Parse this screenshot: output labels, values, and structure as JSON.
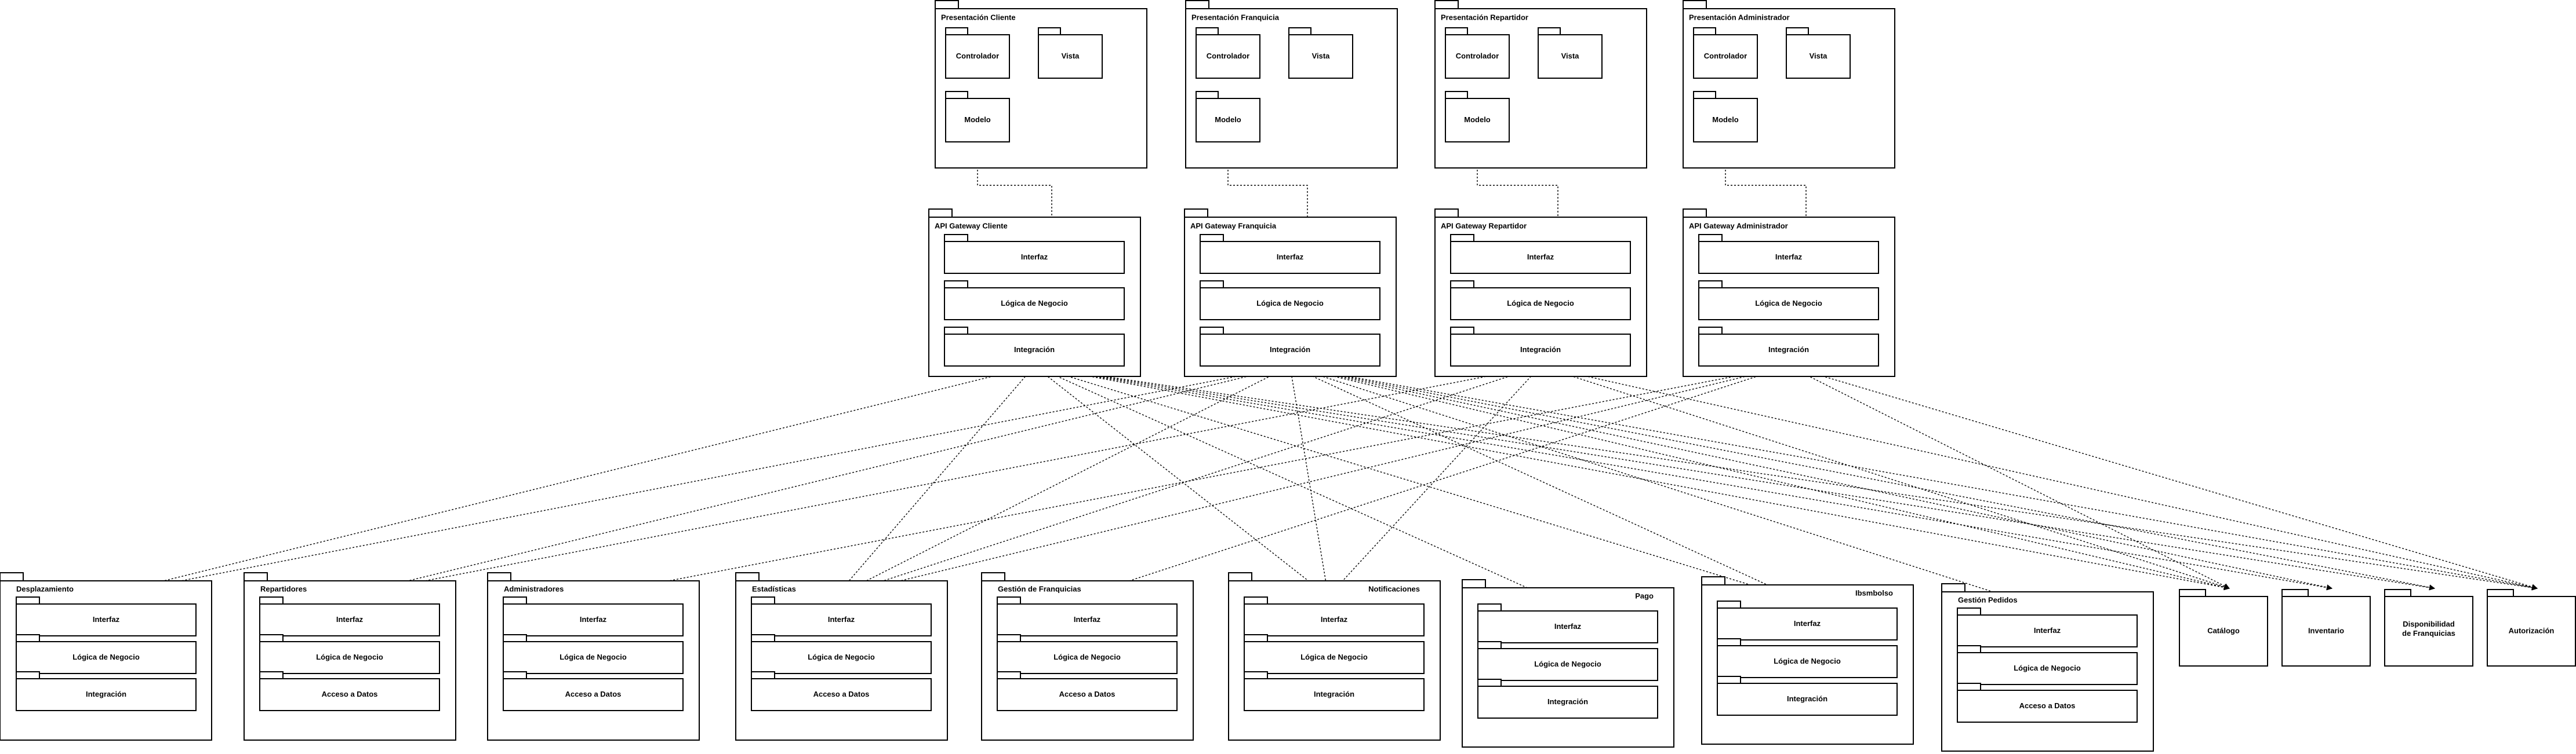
{
  "presentation": [
    {
      "title": "Presentación Cliente",
      "controlador": "Controlador",
      "vista": "Vista",
      "modelo": "Modelo"
    },
    {
      "title": "Presentación Franquicia",
      "controlador": "Controlador",
      "vista": "Vista",
      "modelo": "Modelo"
    },
    {
      "title": "Presentación Repartidor",
      "controlador": "Controlador",
      "vista": "Vista",
      "modelo": "Modelo"
    },
    {
      "title": "Presentación Administrador",
      "controlador": "Controlador",
      "vista": "Vista",
      "modelo": "Modelo"
    }
  ],
  "gateways": [
    {
      "title": "API Gateway Cliente",
      "layers": [
        "Interfaz",
        "Lógica de Negocio",
        "Integración"
      ]
    },
    {
      "title": "API Gateway Franquicia",
      "layers": [
        "Interfaz",
        "Lógica de Negocio",
        "Integración"
      ]
    },
    {
      "title": "API Gateway Repartidor",
      "layers": [
        "Interfaz",
        "Lógica de Negocio",
        "Integración"
      ]
    },
    {
      "title": "API Gateway Administrador",
      "layers": [
        "Interfaz",
        "Lógica de Negocio",
        "Integración"
      ]
    }
  ],
  "services": [
    {
      "title": "Desplazamiento",
      "layers": [
        "Interfaz",
        "Lógica de Negocio",
        "Integración"
      ]
    },
    {
      "title": "Repartidores",
      "layers": [
        "Interfaz",
        "Lógica de Negocio",
        "Acceso a Datos"
      ]
    },
    {
      "title": "Administradores",
      "layers": [
        "Interfaz",
        "Lógica de Negocio",
        "Acceso a Datos"
      ]
    },
    {
      "title": "Estadísticas",
      "layers": [
        "Interfaz",
        "Lógica de Negocio",
        "Acceso a Datos"
      ]
    },
    {
      "title": "Gestión de Franquicias",
      "layers": [
        "Interfaz",
        "Lógica de Negocio",
        "Acceso a Datos"
      ]
    },
    {
      "title": "Notificaciones",
      "layers": [
        "Interfaz",
        "Lógica de Negocio",
        "Integración"
      ]
    },
    {
      "title": "Pago",
      "layers": [
        "Interfaz",
        "Lógica de Negocio",
        "Integración"
      ]
    },
    {
      "title": "Ibsmbolso",
      "layers": [
        "Interfaz",
        "Lógica de Negocio",
        "Integración"
      ]
    },
    {
      "title": "Gestión Pedidos",
      "layers": [
        "Interfaz",
        "Lógica de Negocio",
        "Acceso a Datos"
      ]
    }
  ],
  "components": [
    "Catálogo",
    "Inventario",
    "Disponibilidad de Franquicias",
    "Autorización"
  ]
}
